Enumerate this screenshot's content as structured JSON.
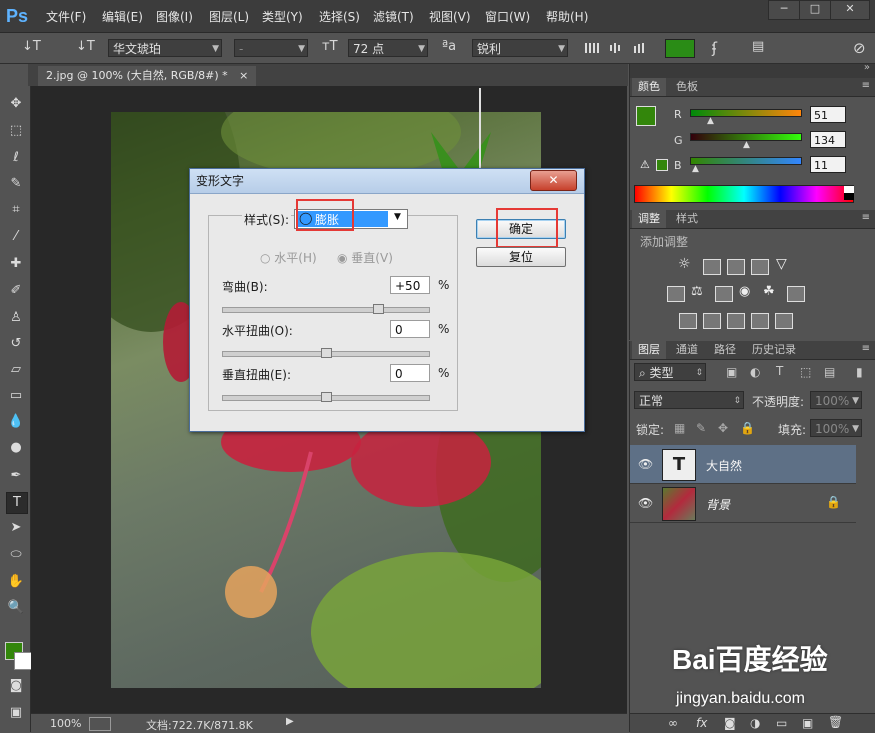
{
  "app": {
    "logo": "Ps"
  },
  "menu": [
    "文件(F)",
    "编辑(E)",
    "图像(I)",
    "图层(L)",
    "类型(Y)",
    "选择(S)",
    "滤镜(T)",
    "视图(V)",
    "窗口(W)",
    "帮助(H)"
  ],
  "window_controls": {
    "minimize": "─",
    "maximize": "□",
    "close": "✕"
  },
  "options_bar": {
    "tool_icon": "↓T",
    "orient_icon": "↓T",
    "font_family": "华文琥珀",
    "font_style": "-",
    "size_icon": "тT",
    "font_size": "72 点",
    "aa_icon": "ªa",
    "antialias": "锐利",
    "text_color": "#2a8c16"
  },
  "document_tab": {
    "title": "2.jpg @ 100% (大自然, RGB/8#) *",
    "close": "×"
  },
  "status_bar": {
    "zoom": "100%",
    "doc": "文档:722.7K/871.8K"
  },
  "color_panel": {
    "tabs": [
      "颜色",
      "色板"
    ],
    "r_label": "R",
    "r": "51",
    "g_label": "G",
    "g": "134",
    "b_label": "B",
    "b": "11",
    "foreground": "#33860b",
    "background": "#ffffff"
  },
  "adjust_panel": {
    "tabs": [
      "调整",
      "样式"
    ],
    "hint": "添加调整"
  },
  "layers_panel": {
    "tabs": [
      "图层",
      "通道",
      "路径",
      "历史记录"
    ],
    "filter": "类型",
    "blend": "正常",
    "opacity_label": "不透明度:",
    "opacity": "100%",
    "lock_label": "锁定:",
    "fill_label": "填充:",
    "fill": "100%",
    "layers": [
      {
        "name": "大自然",
        "thumb": "T"
      },
      {
        "name": "背景",
        "thumb": ""
      }
    ],
    "footer_icons": [
      "∞",
      "fx",
      "◙",
      "◑",
      "▭",
      "▣",
      "🗑"
    ]
  },
  "dialog": {
    "title": "变形文字",
    "close": "✕",
    "style_label": "样式(S):",
    "style_value": "膨胀",
    "horizontal": "水平(H)",
    "vertical": "垂直(V)",
    "bend_label": "弯曲(B):",
    "bend_value": "+50",
    "hdist_label": "水平扭曲(O):",
    "hdist_value": "0",
    "vdist_label": "垂直扭曲(E):",
    "vdist_value": "0",
    "percent": "%",
    "ok": "确定",
    "reset": "复位",
    "bend_level": 0.75,
    "hdist_level": 0.5,
    "vdist_level": 0.5
  },
  "watermark": {
    "logo": "Bai百度经验",
    "url": "jingyan.baidu.com"
  }
}
